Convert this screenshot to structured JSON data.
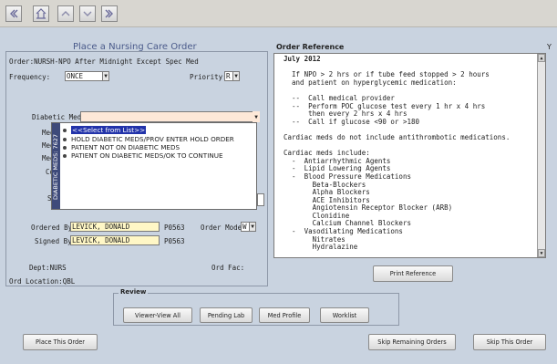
{
  "toolbar": {
    "buttons": [
      "first-icon",
      "home-icon",
      "up-icon",
      "down-icon",
      "last-icon"
    ]
  },
  "left": {
    "title": "Place a Nursing Care Order",
    "order_line": "Order:NURSH-NPO After Midnight Except Spec Med",
    "frequency_label": "Frequency:",
    "frequency_value": "ONCE",
    "priority_label": "Priority:",
    "priority_value": "R",
    "diabetic_label": "Diabetic Med:",
    "diabetic_value": "",
    "partial_labels": [
      "Med",
      "Med",
      "Med",
      "Co",
      "S"
    ],
    "list_sidebar": "DIABETIC MEDS: 7627",
    "list_items": [
      "<<Select from List>>",
      "HOLD DIABETIC MEDS/PROV ENTER HOLD ORDER",
      "PATIENT NOT ON DIABETIC MEDS",
      "PATIENT ON DIABETIC MEDS/OK TO CONTINUE"
    ],
    "ordered_by_label": "Ordered By:",
    "ordered_by_value": "LEVICK, DONALD",
    "ordered_by_code": "P0563",
    "order_mode_label": "Order Mode:",
    "order_mode_value": "W",
    "signed_by_label": "Signed By:",
    "signed_by_value": "LEVICK, DONALD",
    "signed_by_code": "P0563",
    "dept": "Dept:NURS",
    "ord_fac": "Ord Fac:",
    "ord_location": "Ord Location:QBL"
  },
  "reference": {
    "title": "Order Reference",
    "edge": "Y",
    "lines": [
      "July 2012",
      "",
      "  If NPO > 2 hrs or if tube feed stopped > 2 hours",
      "  and patient on hyperglycemic medication:",
      "",
      "  --  Call medical provider",
      "  --  Perform POC glucose test every 1 hr x 4 hrs",
      "      then every 2 hrs x 4 hrs",
      "  --  Call if glucose <90 or >180",
      "",
      "Cardiac meds do not include antithrombotic medications.",
      "",
      "Cardiac meds include:",
      "  -  Antiarrhythmic Agents",
      "  -  Lipid Lowering Agents",
      "  -  Blood Pressure Medications",
      "       Beta-Blockers",
      "       Alpha Blockers",
      "       ACE Inhibitors",
      "       Angiotensin Receptor Blocker (ARB)",
      "       Clonidine",
      "       Calcium Channel Blockers",
      "  -  Vasodilating Medications",
      "       Nitrates",
      "       Hydralazine"
    ],
    "print_button": "Print Reference"
  },
  "review": {
    "label": "Review",
    "buttons": [
      "Viewer-View All",
      "Pending Lab",
      "Med Profile",
      "Worklist"
    ]
  },
  "footer": {
    "place": "Place This Order",
    "skip_remaining": "Skip Remaining Orders",
    "skip_this": "Skip This Order"
  }
}
